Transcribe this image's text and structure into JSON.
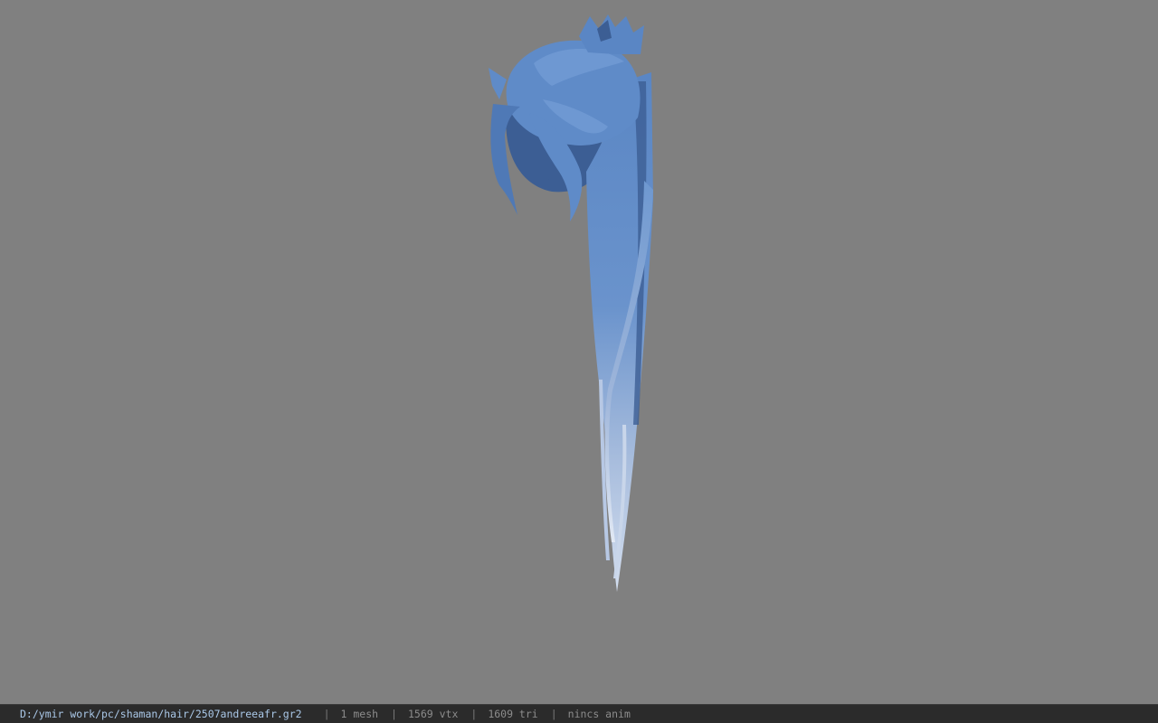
{
  "viewport": {
    "background_color": "#808080",
    "model": {
      "name": "hair-mesh",
      "color_top": "#5a86c4",
      "color_bottom": "#c9d6ea",
      "shadow_color": "#3c5e94"
    }
  },
  "status_bar": {
    "file_path": "D:/ymir work/pc/shaman/hair/2507andreeafr.gr2",
    "separator": "|",
    "mesh_count": "1 mesh",
    "vertex_count": "1569 vtx",
    "triangle_count": "1609 tri",
    "animation": "nincs anim"
  }
}
